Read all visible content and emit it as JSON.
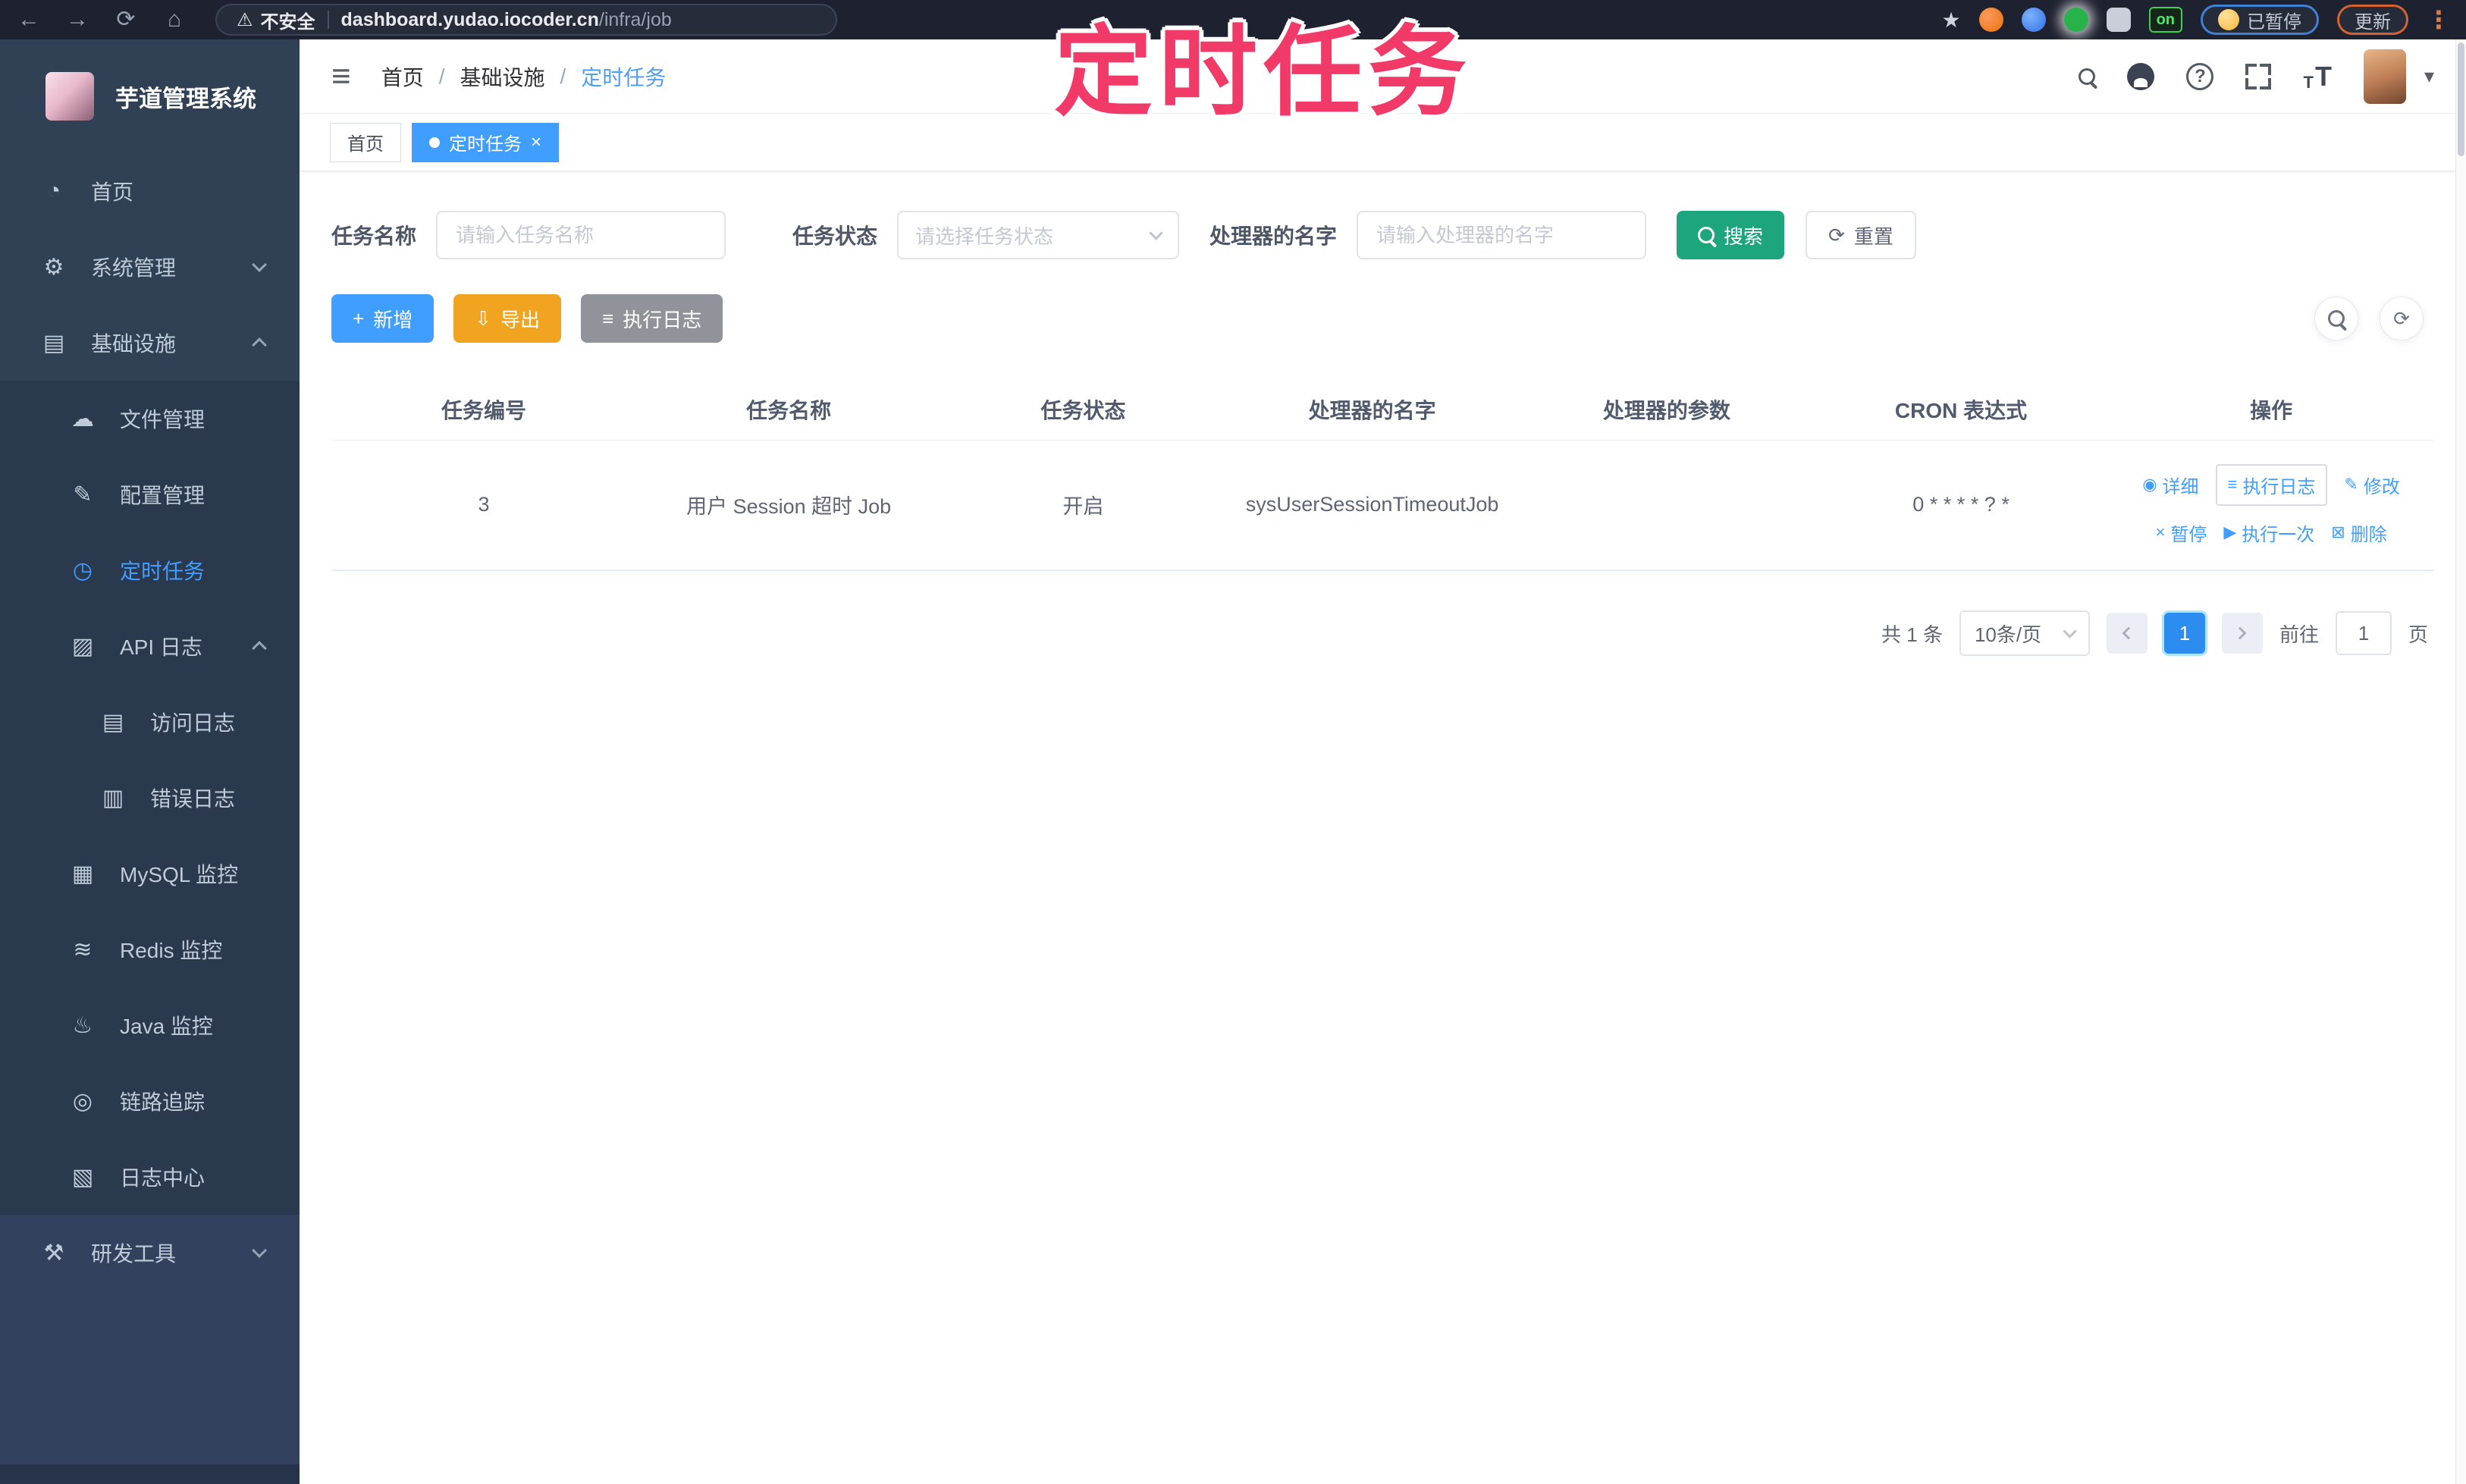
{
  "colors": {
    "accent": "#409eff",
    "search_button": "#1da57e",
    "export_button": "#f0a41f",
    "info_button": "#909399",
    "annotation": "#f23a68",
    "sidebar_bg": "#304156"
  },
  "icons": {
    "back": "←",
    "forward": "→",
    "reload": "⟳",
    "home": "⌂",
    "warning": "⚠",
    "star": "★",
    "dots": "⋮",
    "hamburger": "≡",
    "question": "?",
    "text_big": "T",
    "text_small": "T",
    "caret_down": "▾",
    "close": "×",
    "plus": "+",
    "download": "⇩",
    "list": "≡",
    "refresh": "⟳",
    "eye": "◉",
    "edit": "✎",
    "pause": "×",
    "play": "▶",
    "trash": "⊠"
  },
  "browser": {
    "security_label": "不安全",
    "url_host": "dashboard.yudao.iocoder.cn",
    "url_path": "/infra/job",
    "on_badge": "on",
    "paused_label": "已暂停",
    "update_label": "更新"
  },
  "annotation": {
    "text": "定时任务"
  },
  "sidebar": {
    "title": "芋道管理系统",
    "items": [
      {
        "label": "首页",
        "icon": "◔"
      },
      {
        "label": "系统管理",
        "icon": "⚙"
      },
      {
        "label": "基础设施",
        "icon": "▤"
      },
      {
        "label": "文件管理",
        "icon": "☁"
      },
      {
        "label": "配置管理",
        "icon": "✎"
      },
      {
        "label": "定时任务",
        "icon": "◷"
      },
      {
        "label": "API 日志",
        "icon": "▨"
      },
      {
        "label": "访问日志",
        "icon": "▤"
      },
      {
        "label": "错误日志",
        "icon": "▥"
      },
      {
        "label": "MySQL 监控",
        "icon": "▦"
      },
      {
        "label": "Redis 监控",
        "icon": "≋"
      },
      {
        "label": "Java 监控",
        "icon": "♨"
      },
      {
        "label": "链路追踪",
        "icon": "◎"
      },
      {
        "label": "日志中心",
        "icon": "▧"
      },
      {
        "label": "研发工具",
        "icon": "⚒"
      }
    ]
  },
  "navbar": {
    "breadcrumb": [
      "首页",
      "基础设施",
      "定时任务"
    ],
    "separator": "/"
  },
  "tags": [
    {
      "label": "首页"
    },
    {
      "label": "定时任务"
    }
  ],
  "filters": {
    "fields": [
      {
        "label": "任务名称",
        "placeholder": "请输入任务名称"
      },
      {
        "label": "任务状态",
        "placeholder": "请选择任务状态"
      },
      {
        "label": "处理器的名字",
        "placeholder": "请输入处理器的名字"
      }
    ],
    "search_label": "搜索",
    "reset_label": "重置"
  },
  "toolbar": {
    "add_label": "新增",
    "export_label": "导出",
    "exec_log_label": "执行日志"
  },
  "table": {
    "columns": [
      "任务编号",
      "任务名称",
      "任务状态",
      "处理器的名字",
      "处理器的参数",
      "CRON 表达式",
      "操作"
    ],
    "rows": [
      {
        "id": "3",
        "name": "用户 Session 超时 Job",
        "status": "开启",
        "handler": "sysUserSessionTimeoutJob",
        "param": "",
        "cron": "0 * * * * ? *"
      }
    ],
    "actions": {
      "detail": "详细",
      "exec_log": "执行日志",
      "edit": "修改",
      "pause": "暂停",
      "run_once": "执行一次",
      "delete": "删除"
    }
  },
  "pagination": {
    "total": "共 1 条",
    "page_size": "10条/页",
    "current_page": "1",
    "goto_label": "前往",
    "page_unit": "页",
    "goto_value": "1"
  }
}
